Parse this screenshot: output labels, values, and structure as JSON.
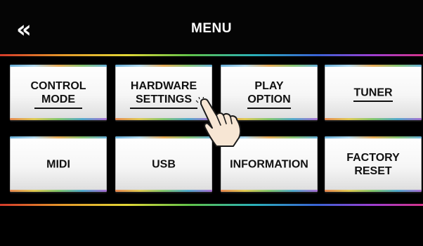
{
  "header": {
    "back_icon": "double-chevron-left-icon",
    "back_glyph": "«",
    "title": "MENU"
  },
  "menu": [
    {
      "label": "CONTROL\nMODE",
      "underlined": true
    },
    {
      "label": "HARDWARE\nSETTINGS",
      "underlined": true
    },
    {
      "label": "PLAY\nOPTION",
      "underlined": true
    },
    {
      "label": "TUNER",
      "underlined": true
    },
    {
      "label": "MIDI",
      "underlined": false
    },
    {
      "label": "USB",
      "underlined": false
    },
    {
      "label": "INFORMATION",
      "underlined": false
    },
    {
      "label": "FACTORY\nRESET",
      "underlined": false
    }
  ],
  "pointer": {
    "icon": "tapping-hand-icon",
    "target": "HARDWARE SETTINGS"
  }
}
